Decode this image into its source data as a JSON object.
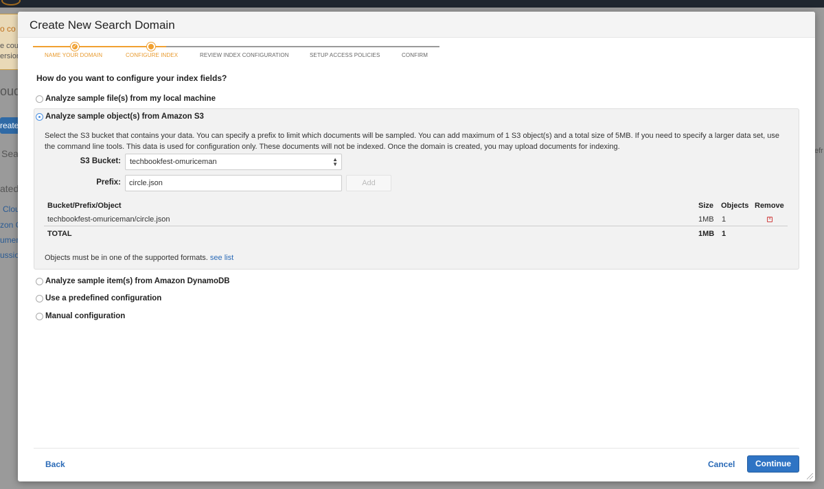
{
  "background": {
    "notice_line1": "o co",
    "notice_line2": "e cou",
    "notice_line3": "ersion",
    "heading": "oud",
    "create_button": "reate",
    "search_label": "Sea",
    "refresh_fragment": "efr",
    "related_label": "ated",
    "links": [
      "Clou",
      "zon C",
      "umen",
      "ussio"
    ]
  },
  "modal": {
    "title": "Create New Search Domain",
    "steps": [
      {
        "label": "NAME YOUR DOMAIN",
        "state": "done"
      },
      {
        "label": "CONFIGURE INDEX",
        "state": "active"
      },
      {
        "label": "REVIEW INDEX CONFIGURATION",
        "state": "pending"
      },
      {
        "label": "SETUP ACCESS POLICIES",
        "state": "pending"
      },
      {
        "label": "CONFIRM",
        "state": "pending"
      }
    ],
    "question": "How do you want to configure your index fields?",
    "options": {
      "local": "Analyze sample file(s) from my local machine",
      "s3": "Analyze sample object(s) from Amazon S3",
      "dynamodb": "Analyze sample item(s) from Amazon DynamoDB",
      "predefined": "Use a predefined configuration",
      "manual": "Manual configuration"
    },
    "selected_option": "s3",
    "s3": {
      "description": "Select the S3 bucket that contains your data. You can specify a prefix to limit which documents will be sampled. You can add maximum of 1 S3 object(s) and a total size of 5MB. If you need to specify a larger data set, use the command line tools. This data is used for configuration only. These documents will not be indexed. Once the domain is created, you may upload documents for indexing.",
      "bucket_label": "S3 Bucket:",
      "bucket_value": "techbookfest-omuriceman",
      "prefix_label": "Prefix:",
      "prefix_value": "circle.json",
      "add_button": "Add",
      "table": {
        "headers": {
          "object": "Bucket/Prefix/Object",
          "size": "Size",
          "objects": "Objects",
          "remove": "Remove"
        },
        "row": {
          "object": "techbookfest-omuriceman/circle.json",
          "size": "1MB",
          "objects": "1"
        },
        "total": {
          "label": "TOTAL",
          "size": "1MB",
          "objects": "1"
        }
      },
      "formats_text": "Objects must be in one of the supported formats.",
      "formats_link": "see list"
    },
    "footer": {
      "back": "Back",
      "cancel": "Cancel",
      "continue": "Continue"
    }
  },
  "colors": {
    "accent_orange": "#f0a030",
    "primary_blue": "#2f74c4",
    "link_blue": "#2a6ab7"
  }
}
